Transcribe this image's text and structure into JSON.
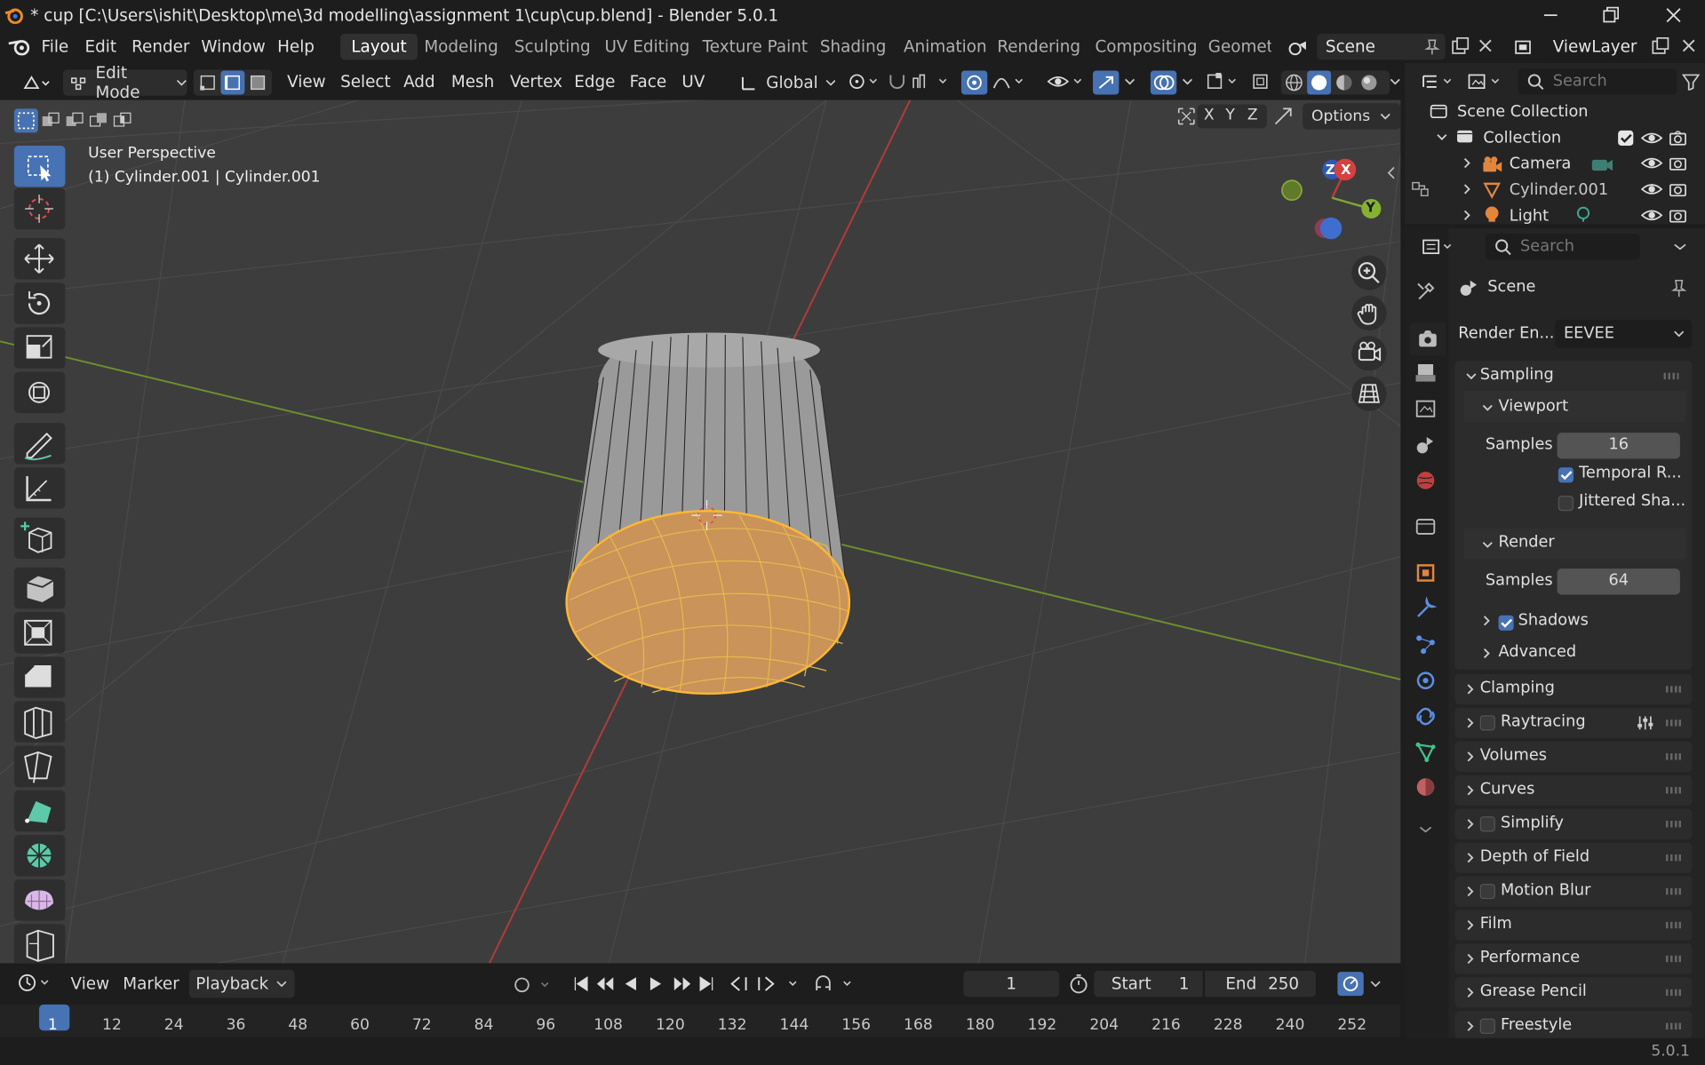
{
  "window": {
    "title": "* cup [C:\\Users\\ishit\\Desktop\\me\\3d modelling\\assignment 1\\cup\\cup.blend] - Blender 5.0.1"
  },
  "menu": [
    "File",
    "Edit",
    "Render",
    "Window",
    "Help"
  ],
  "workspaces": [
    "Layout",
    "Modeling",
    "Sculpting",
    "UV Editing",
    "Texture Paint",
    "Shading",
    "Animation",
    "Rendering",
    "Compositing",
    "Geometr"
  ],
  "scene_field": "Scene",
  "viewlayer_field": "ViewLayer",
  "header": {
    "mode": "Edit Mode",
    "menus": [
      "View",
      "Select",
      "Add",
      "Mesh",
      "Vertex",
      "Edge",
      "Face",
      "UV"
    ],
    "orientation": "Global",
    "options": "Options",
    "axes": [
      "X",
      "Y",
      "Z"
    ]
  },
  "viewport": {
    "perspective": "User Perspective",
    "object_info": "(1) Cylinder.001 | Cylinder.001",
    "gizmo": {
      "x": "X",
      "y": "Y",
      "z": "Z"
    }
  },
  "outliner": {
    "search_placeholder": "Search",
    "root": "Scene Collection",
    "collection": "Collection",
    "items": [
      "Camera",
      "Cylinder.001",
      "Light"
    ]
  },
  "properties": {
    "search_placeholder": "Search",
    "context": "Scene",
    "render_engine_label": "Render En...",
    "render_engine": "EEVEE",
    "sampling": "Sampling",
    "viewport": "Viewport",
    "samples_label": "Samples",
    "viewport_samples": "16",
    "temporal": "Temporal R...",
    "jittered": "Jittered Sha...",
    "render": "Render",
    "render_samples": "64",
    "shadows": "Shadows",
    "advanced": "Advanced",
    "panels": [
      "Clamping",
      "Raytracing",
      "Volumes",
      "Curves",
      "Simplify",
      "Depth of Field",
      "Motion Blur",
      "Film",
      "Performance",
      "Grease Pencil",
      "Freestyle"
    ]
  },
  "timeline": {
    "menus": [
      "View",
      "Marker",
      "Playback"
    ],
    "current_frame": "1",
    "start_label": "Start",
    "start": "1",
    "end_label": "End",
    "end": "250",
    "frames": [
      "1",
      "12",
      "24",
      "36",
      "48",
      "60",
      "72",
      "84",
      "96",
      "108",
      "120",
      "132",
      "144",
      "156",
      "168",
      "180",
      "192",
      "204",
      "216",
      "228",
      "240",
      "252"
    ]
  },
  "status": {
    "version": "5.0.1"
  }
}
